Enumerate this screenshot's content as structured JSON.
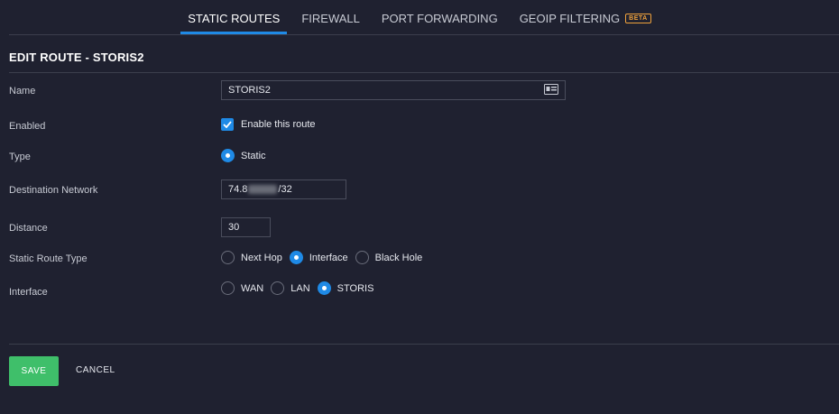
{
  "tabs": [
    {
      "label": "STATIC ROUTES"
    },
    {
      "label": "FIREWALL"
    },
    {
      "label": "PORT FORWARDING"
    },
    {
      "label": "GEOIP FILTERING",
      "badge": "BETA"
    }
  ],
  "page_title": "EDIT ROUTE - STORIS2",
  "form": {
    "name_label": "Name",
    "name_value": "STORIS2",
    "enabled_label": "Enabled",
    "enabled_checkbox_label": "Enable this route",
    "type_label": "Type",
    "type_option": "Static",
    "dest_label": "Destination Network",
    "dest_prefix": "74.8",
    "dest_suffix": "/32",
    "distance_label": "Distance",
    "distance_value": "30",
    "route_type_label": "Static Route Type",
    "route_type_options": [
      "Next Hop",
      "Interface",
      "Black Hole"
    ],
    "route_type_selected": "Interface",
    "interface_label": "Interface",
    "interface_options": [
      "WAN",
      "LAN",
      "STORIS"
    ],
    "interface_selected": "STORIS"
  },
  "buttons": {
    "save": "SAVE",
    "cancel": "CANCEL"
  },
  "colors": {
    "accent": "#1f8ae6",
    "save": "#3fbf6a",
    "beta": "#f0a23c",
    "background": "#1f2130"
  }
}
